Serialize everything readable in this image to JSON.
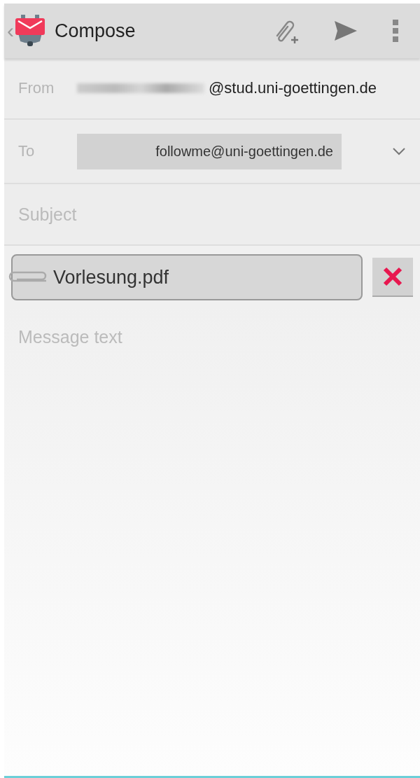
{
  "toolbar": {
    "back": "‹",
    "title": "Compose"
  },
  "from": {
    "label": "From",
    "address": "@stud.uni-goettingen.de"
  },
  "to": {
    "label": "To",
    "recipients": [
      "followme@uni-goettingen.de"
    ]
  },
  "subject": {
    "placeholder": "Subject"
  },
  "attachments": [
    {
      "name": "Vorlesung.pdf"
    }
  ],
  "message": {
    "placeholder": "Message text"
  }
}
